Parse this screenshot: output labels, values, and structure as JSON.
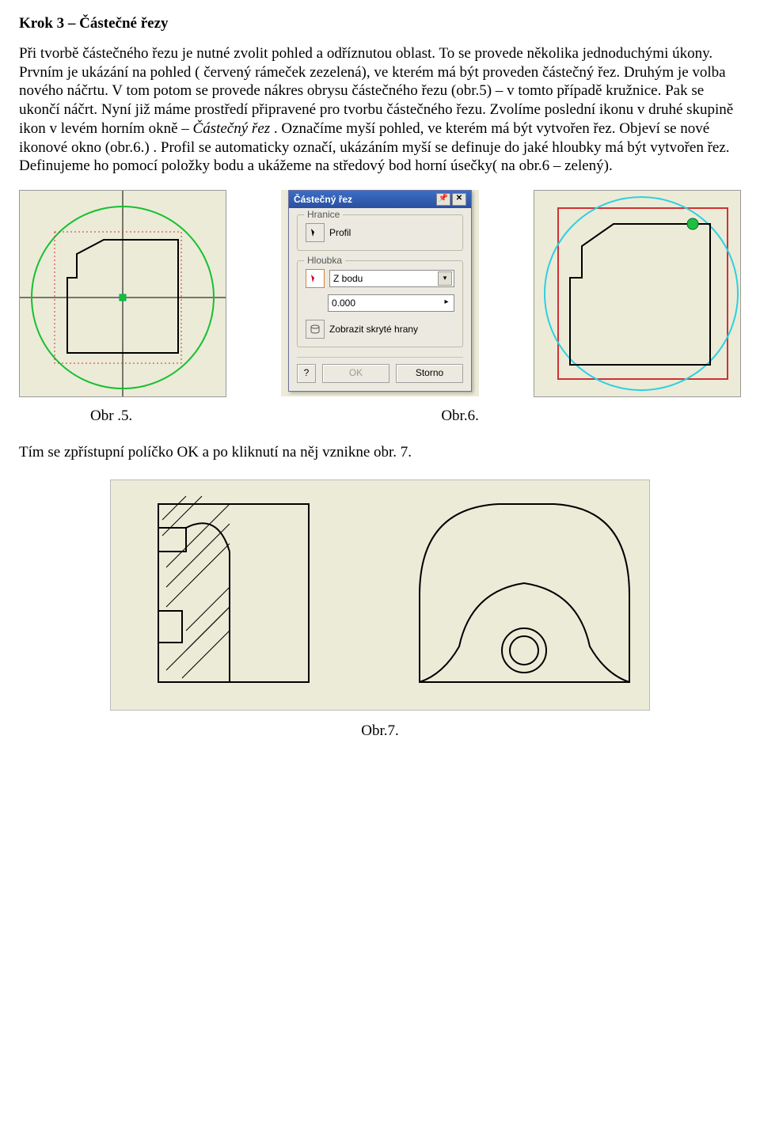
{
  "heading": "Krok 3 – Částečné řezy",
  "para1_part1": "Při tvorbě částečného řezu je nutné zvolit pohled a odříznutou oblast. To se provede několika jednoduchými úkony. Prvním je ukázání na pohled ( červený rámeček zezelená), ve kterém má být proveden částečný řez. Druhým je volba nového náčrtu. V tom potom se provede nákres obrysu částečného řezu (obr.5) – v tomto případě kružnice. Pak se ukončí náčrt. Nyní již máme prostředí připravené pro tvorbu částečného řezu. Zvolíme poslední ikonu v druhé skupině ikon v levém horním okně – ",
  "para1_italic": "Částečný řez",
  "para1_part2": ". Označíme myší pohled, ve kterém má být vytvořen řez. Objeví se nové ikonové okno (obr.6.) . Profil se automaticky označí, ukázáním myší se definuje do jaké hloubky má být vytvořen řez. Definujeme ho pomocí položky bodu a ukážeme na středový bod horní úsečky( na obr.6 – zelený).",
  "dialog": {
    "title": "Částečný řez",
    "group_hranice": "Hranice",
    "profil_label": "Profil",
    "group_hloubka": "Hloubka",
    "combo_value": "Z bodu",
    "input_value": "0.000",
    "hidden_edges": "Zobrazit skryté hrany",
    "ok": "OK",
    "cancel": "Storno",
    "pin": "📌",
    "close": "✕",
    "help": "?"
  },
  "captions": {
    "fig5": "Obr .5.",
    "fig6": "Obr.6.",
    "fig7": "Obr.7."
  },
  "after_figs": "Tím se zpřístupní políčko OK a po kliknutí na něj vznikne obr. 7."
}
